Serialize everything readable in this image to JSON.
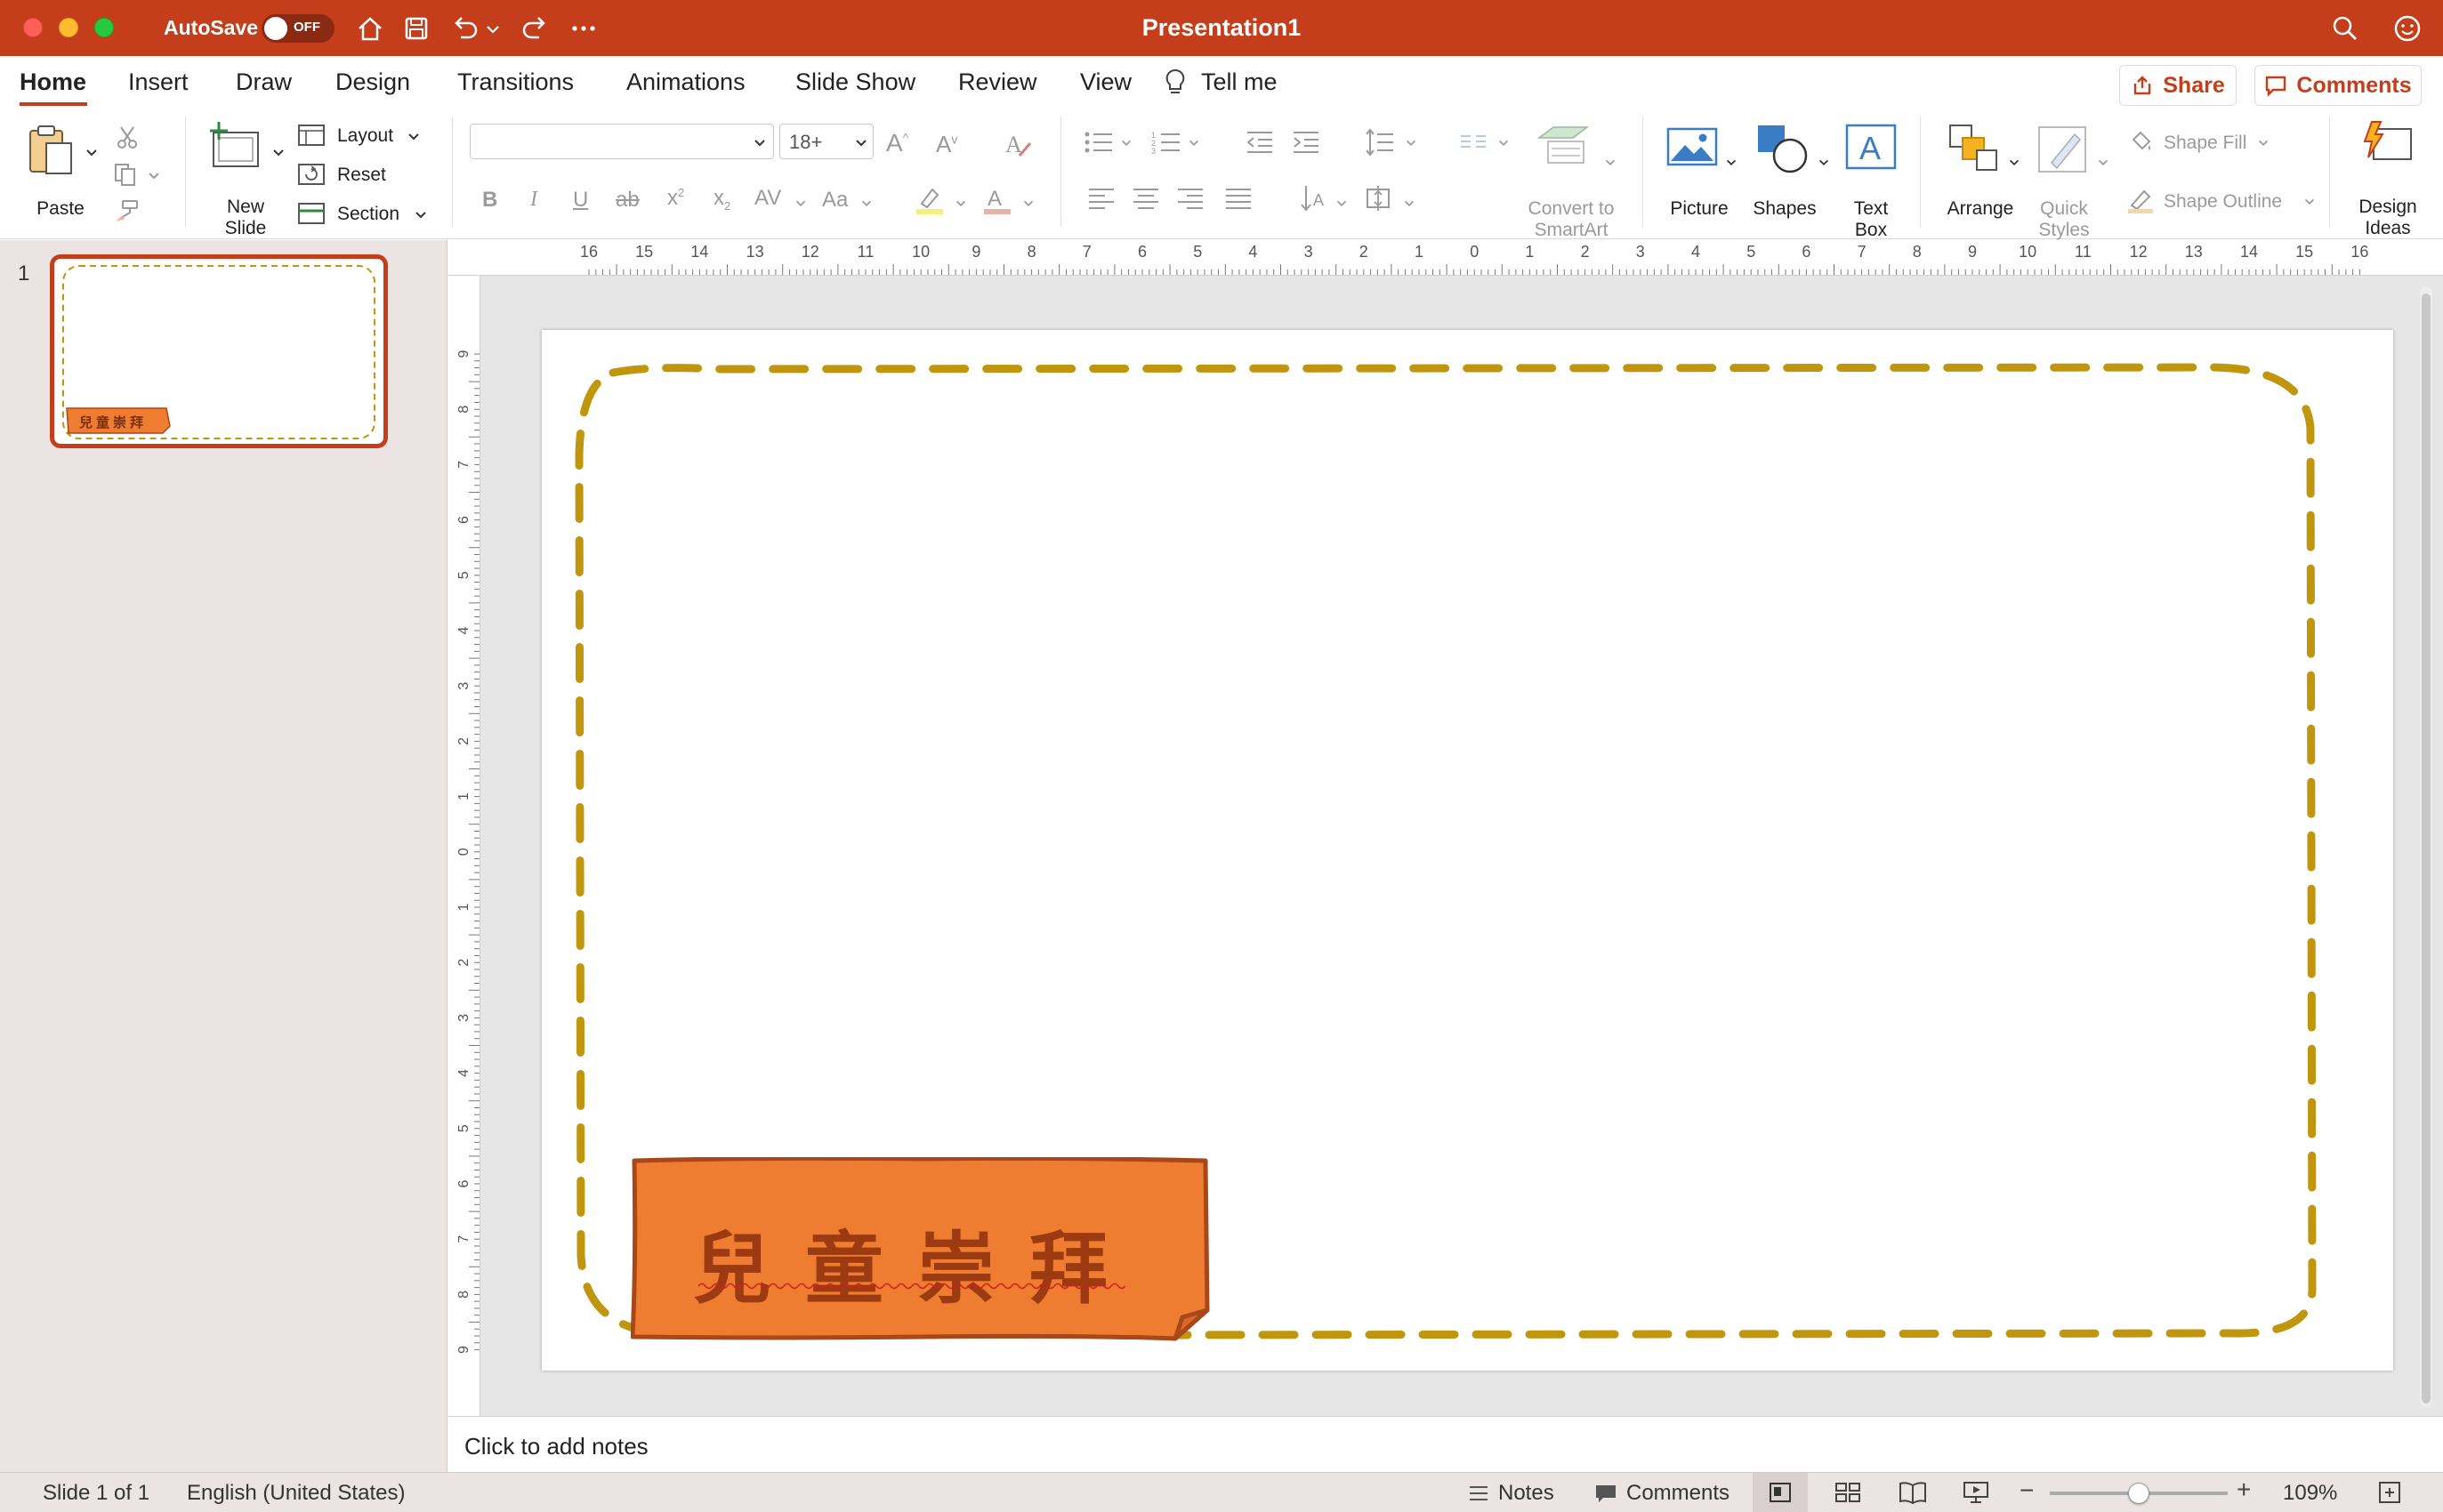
{
  "titlebar": {
    "autosave_label": "AutoSave",
    "autosave_state": "OFF",
    "title": "Presentation1"
  },
  "tabs": [
    "Home",
    "Insert",
    "Draw",
    "Design",
    "Transitions",
    "Animations",
    "Slide Show",
    "Review",
    "View"
  ],
  "tell_me": "Tell me",
  "share_label": "Share",
  "comments_label": "Comments",
  "ribbon": {
    "paste": "Paste",
    "new_slide": [
      "New",
      "Slide"
    ],
    "layout": "Layout",
    "reset": "Reset",
    "section": "Section",
    "font_name": "",
    "font_size": "18+",
    "convert_smartart": [
      "Convert to",
      "SmartArt"
    ],
    "picture": "Picture",
    "shapes": "Shapes",
    "text_box": [
      "Text",
      "Box"
    ],
    "arrange": "Arrange",
    "quick_styles": [
      "Quick",
      "Styles"
    ],
    "shape_fill": "Shape Fill",
    "shape_outline": "Shape Outline",
    "design_ideas": [
      "Design",
      "Ideas"
    ]
  },
  "ruler": {
    "h_ticks": [
      "16",
      "15",
      "14",
      "13",
      "12",
      "11",
      "10",
      "9",
      "8",
      "7",
      "6",
      "5",
      "4",
      "3",
      "2",
      "1",
      "0",
      "1",
      "2",
      "3",
      "4",
      "5",
      "6",
      "7",
      "8",
      "9",
      "10",
      "11",
      "12",
      "13",
      "14",
      "15",
      "16"
    ],
    "v_ticks": [
      "9",
      "8",
      "7",
      "6",
      "5",
      "4",
      "3",
      "2",
      "1",
      "0",
      "1",
      "2",
      "3",
      "4",
      "5",
      "6",
      "7",
      "8",
      "9"
    ]
  },
  "thumbnails": [
    {
      "number": "1",
      "banner_text": "兒童崇拜"
    }
  ],
  "slide": {
    "banner_text": "兒童崇拜"
  },
  "notes_placeholder": "Click to add notes",
  "status": {
    "slide_count": "Slide 1 of 1",
    "language": "English (United States)",
    "notes": "Notes",
    "comments": "Comments",
    "zoom": "109%"
  },
  "colors": {
    "brand": "#c43e1c",
    "dash_border": "#c0960f",
    "banner_fill": "#ef7d31",
    "banner_text": "#9c3a12"
  }
}
